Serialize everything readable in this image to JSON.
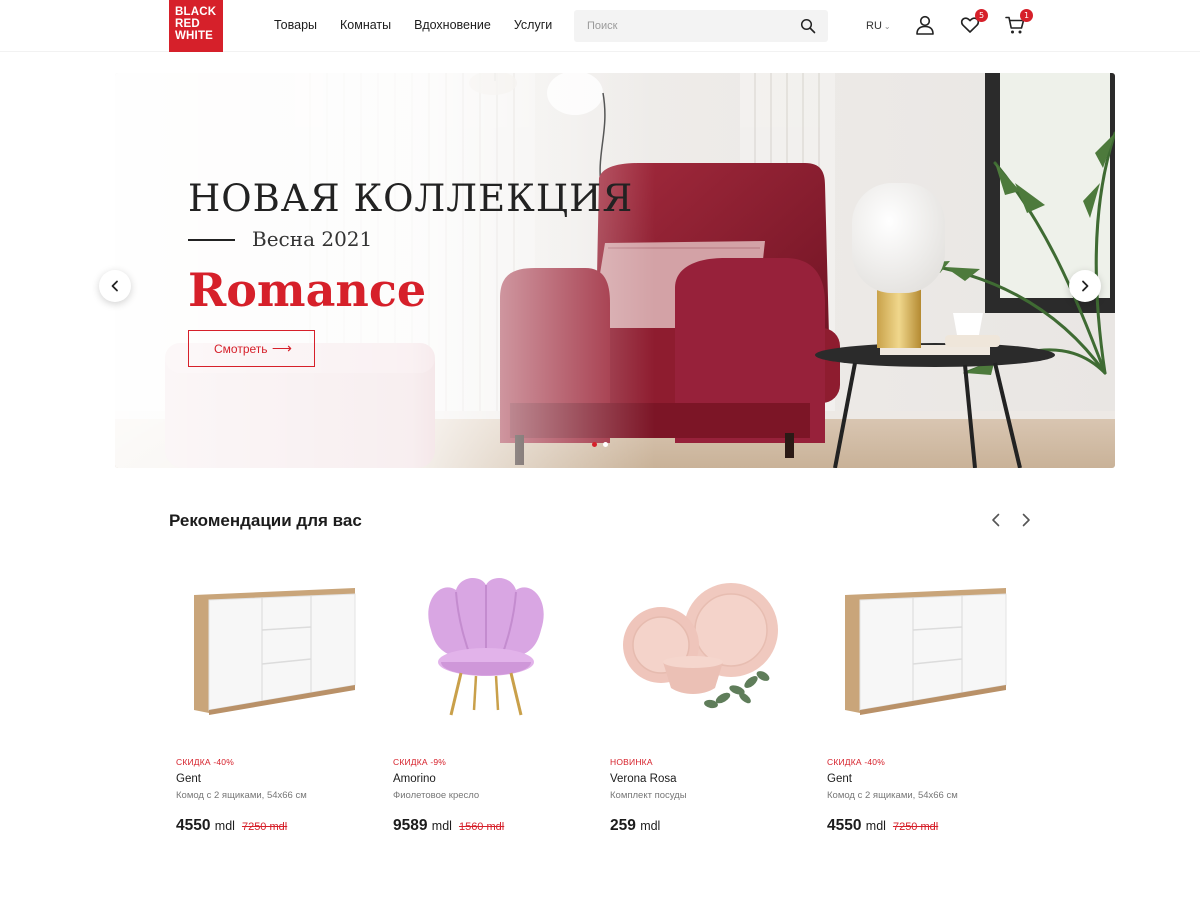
{
  "header": {
    "logo_lines": [
      "BLACK",
      "RED",
      "WHITE"
    ],
    "nav": [
      "Товары",
      "Комнаты",
      "Вдохновение",
      "Услуги"
    ],
    "search_placeholder": "Поиск",
    "language": "RU",
    "wishlist_count": "5",
    "cart_count": "1"
  },
  "hero": {
    "title": "НОВАЯ КОЛЛЕКЦИЯ",
    "subtitle": "Весна 2021",
    "collection_name": "Romance",
    "button_label": "Смотреть",
    "slides_count": 2,
    "active_slide": 1
  },
  "recommendations": {
    "title": "Рекомендации для вас",
    "products": [
      {
        "tag": "СКИДКА -40%",
        "name": "Gent",
        "description": "Комод с 2 ящиками, 54x66 см",
        "price": "4550",
        "currency": "mdl",
        "old_price": "7250 mdl",
        "icon": "dresser-icon"
      },
      {
        "tag": "СКИДКА -9%",
        "name": "Amorino",
        "description": "Фиолетовое кресло",
        "price": "9589",
        "currency": "mdl",
        "old_price": "1560 mdl",
        "icon": "armchair-icon"
      },
      {
        "tag": "НОВИНКА",
        "name": "Verona Rosa",
        "description": "Комплект посуды",
        "price": "259",
        "currency": "mdl",
        "old_price": "",
        "icon": "dinnerware-icon"
      },
      {
        "tag": "СКИДКА -40%",
        "name": "Gent",
        "description": "Комод с 2 ящиками, 54x66 см",
        "price": "4550",
        "currency": "mdl",
        "old_price": "7250 mdl",
        "icon": "dresser-icon"
      }
    ]
  },
  "colors": {
    "brand_red": "#d6202a",
    "armchair_burgundy": "#8e1c2f",
    "text_dark": "#1c1c1c",
    "text_muted": "#777777"
  }
}
